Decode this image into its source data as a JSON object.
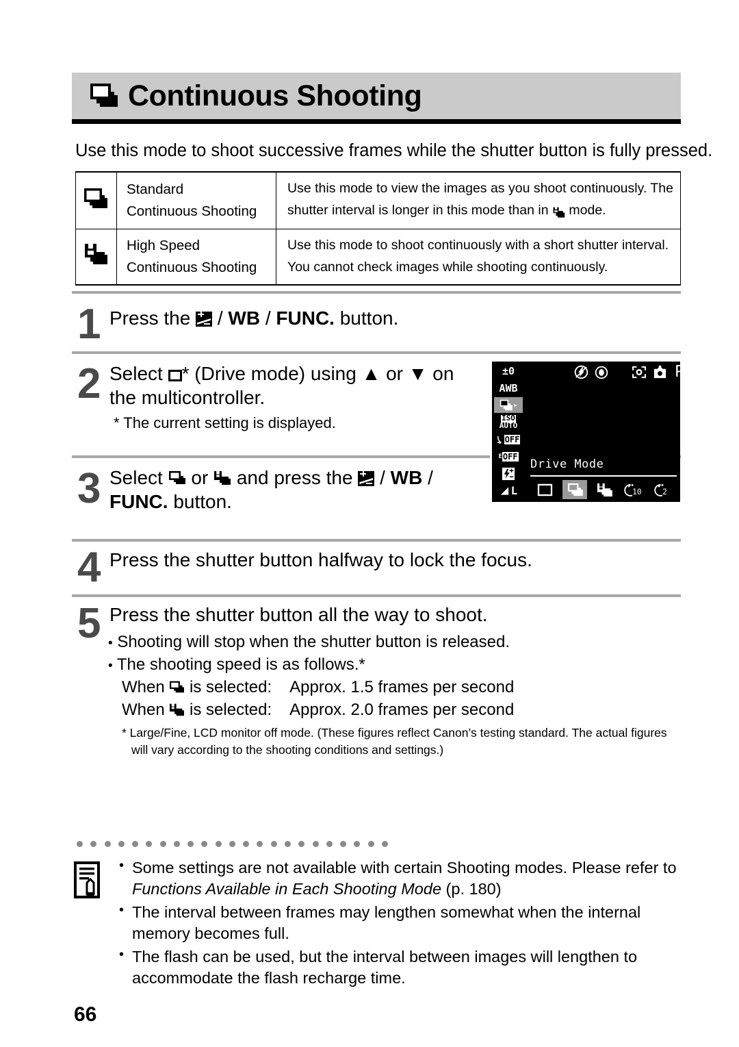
{
  "document": {
    "page_number": "66",
    "title": "Continuous Shooting",
    "title_icon": "continuous-shooting-icon",
    "intro": "Use this mode to shoot successive frames while the shutter button is fully pressed."
  },
  "mode_table": {
    "rows": [
      {
        "icon": "continuous-shooting-icon",
        "name_line1": "Standard",
        "name_line2": "Continuous Shooting",
        "desc_line1": "Use this mode to view the images as you shoot continuously. The",
        "desc_line2_before": "shutter interval is longer in this mode than in",
        "desc_line2_icon": "high-speed-continuous-icon",
        "desc_line2_after": "mode."
      },
      {
        "icon": "high-speed-continuous-icon",
        "name_line1": "High Speed",
        "name_line2": "Continuous Shooting",
        "desc_line1": "Use this mode to shoot continuously with a short shutter interval.",
        "desc_line2_before": "You cannot check images while shooting continuously.",
        "desc_line2_icon": "",
        "desc_line2_after": ""
      }
    ]
  },
  "steps": [
    {
      "number": "1",
      "text_a": "Press the",
      "icon_ev": "exposure-compensation-icon",
      "sep1": "/",
      "wb": "WB",
      "sep2": "/",
      "func": "FUNC.",
      "text_b": "button."
    },
    {
      "number": "2",
      "line1_a": "Select",
      "line1_icon": "single-frame-icon",
      "line1_b": "* (Drive mode) using",
      "up_arrow": "▲",
      "line1_c": "or",
      "down_arrow": "▼",
      "line1_d": "on",
      "line2": "the multicontroller.",
      "sub": "* The current setting is displayed."
    },
    {
      "number": "3",
      "line1_a": "Select",
      "icon_std": "continuous-shooting-icon",
      "line1_b": "or",
      "icon_high": "high-speed-continuous-icon",
      "line1_c": "and press the",
      "icon_ev": "exposure-compensation-icon",
      "sep1": "/",
      "wb": "WB",
      "sep2": "/",
      "line2_func": "FUNC.",
      "line2_b": "button."
    },
    {
      "number": "4",
      "text": "Press the shutter button halfway to lock the focus."
    },
    {
      "number": "5",
      "text": "Press the shutter button all the way to shoot.",
      "bullets": [
        "Shooting will stop when the shutter button is released.",
        "The shooting speed is as follows.*"
      ],
      "speed_rows": [
        {
          "prefix": "When",
          "icon": "continuous-shooting-icon",
          "middle": "is selected:",
          "value": "Approx. 1.5 frames per second"
        },
        {
          "prefix": "When",
          "icon": "high-speed-continuous-icon",
          "middle": "is selected:",
          "value": "Approx. 2.0 frames per second"
        }
      ],
      "footnote_line1": "* Large/Fine, LCD monitor off mode. (These figures reflect Canon’s testing standard. The actual figures",
      "footnote_line2": "will vary according to the shooting conditions and settings.)"
    }
  ],
  "lcd": {
    "exposure_value": "±0",
    "white_balance": "AWB",
    "drive_mode_icon": "continuous-shooting-icon",
    "drive_mode_arrow": "▸",
    "iso_line1": "ISO",
    "iso_line2": "AUTO",
    "effect_off": "OFF",
    "bracket_off": "OFF",
    "flash_exposure_icon": "flash-exposure-comp-icon",
    "quality": "L",
    "top_icons": [
      "flash-off-icon",
      "red-eye-icon",
      "metering-frame-icon",
      "camera-icon"
    ],
    "shooting_mode": "P",
    "menu_label": "Drive Mode",
    "drive_options": [
      {
        "name": "single-frame-icon",
        "selected": false
      },
      {
        "name": "continuous-shooting-icon",
        "selected": true
      },
      {
        "name": "high-speed-continuous-icon",
        "selected": false
      },
      {
        "name": "self-timer-10s-icon",
        "label": "10",
        "selected": false
      },
      {
        "name": "self-timer-2s-icon",
        "label": "2",
        "selected": false
      }
    ]
  },
  "notes": {
    "items": [
      {
        "text_a": "Some settings are not available with certain Shooting modes.  Please refer to",
        "italic": "Functions Available in Each Shooting Mode",
        "text_b": "(p. 180)"
      },
      {
        "text_a": "The interval between frames may lengthen somewhat when the internal memory becomes full.",
        "italic": "",
        "text_b": ""
      },
      {
        "text_a": "The flash can be used, but the interval between images will lengthen to accommodate the flash recharge time.",
        "italic": "",
        "text_b": ""
      }
    ]
  },
  "colors": {
    "title_bar_bg": "#cacaca",
    "separator": "#a8a8a8",
    "step_number": "#4a4a4a",
    "lcd_bg": "#000000",
    "lcd_highlight": "#9a9a9a"
  }
}
